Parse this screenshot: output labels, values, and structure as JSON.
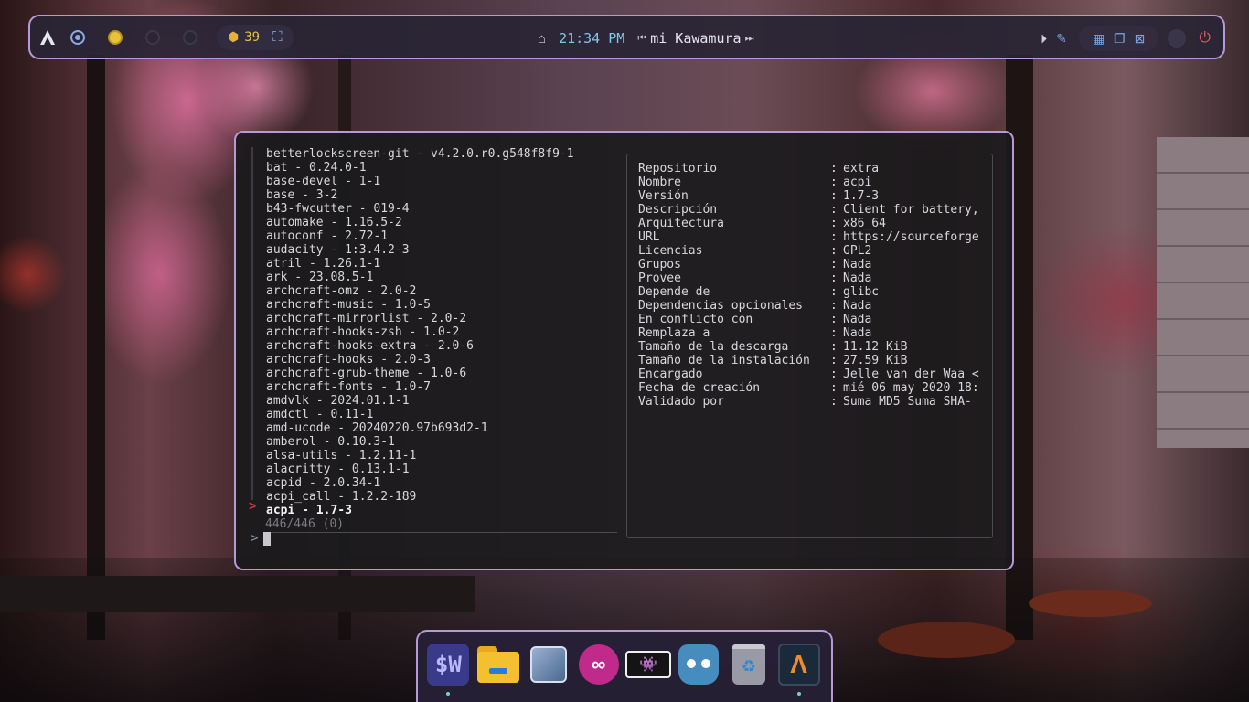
{
  "topbar": {
    "launcher_icon": "arch-logo-icon",
    "workspaces": [
      "workspace-1",
      "workspace-2",
      "workspace-3",
      "workspace-4"
    ],
    "updates_count": "39",
    "clock": "21:34 PM",
    "now_playing": "mi Kawamura"
  },
  "terminal": {
    "packages": [
      "betterlockscreen-git - v4.2.0.r0.g548f8f9-1",
      "bat - 0.24.0-1",
      "base-devel - 1-1",
      "base - 3-2",
      "b43-fwcutter - 019-4",
      "automake - 1.16.5-2",
      "autoconf - 2.72-1",
      "audacity - 1:3.4.2-3",
      "atril - 1.26.1-1",
      "ark - 23.08.5-1",
      "archcraft-omz - 2.0-2",
      "archcraft-music - 1.0-5",
      "archcraft-mirrorlist - 2.0-2",
      "archcraft-hooks-zsh - 1.0-2",
      "archcraft-hooks-extra - 2.0-6",
      "archcraft-hooks - 2.0-3",
      "archcraft-grub-theme - 1.0-6",
      "archcraft-fonts - 1.0-7",
      "amdvlk - 2024.01.1-1",
      "amdctl - 0.11-1",
      "amd-ucode - 20240220.97b693d2-1",
      "amberol - 0.10.3-1",
      "alsa-utils - 1.2.11-1",
      "alacritty - 0.13.1-1",
      "acpid - 2.0.34-1",
      "acpi_call - 1.2.2-189"
    ],
    "selected_package": "acpi - 1.7-3",
    "match_count": "446/446 (0)",
    "selection_marker": ">",
    "prompt_symbol": ">",
    "info": [
      {
        "key": "Repositorio",
        "value": "extra"
      },
      {
        "key": "Nombre",
        "value": "acpi"
      },
      {
        "key": "Versión",
        "value": "1.7-3"
      },
      {
        "key": "Descripción",
        "value": "Client for battery,"
      },
      {
        "key": "Arquitectura",
        "value": "x86_64"
      },
      {
        "key": "URL",
        "value": "https://sourceforge"
      },
      {
        "key": "Licencias",
        "value": "GPL2"
      },
      {
        "key": "Grupos",
        "value": "Nada"
      },
      {
        "key": "Provee",
        "value": "Nada"
      },
      {
        "key": "Depende de",
        "value": "glibc"
      },
      {
        "key": "Dependencias opcionales",
        "value": "Nada"
      },
      {
        "key": "En conflicto con",
        "value": "Nada"
      },
      {
        "key": "Remplaza a",
        "value": "Nada"
      },
      {
        "key": "Tamaño de la descarga",
        "value": "11.12 KiB"
      },
      {
        "key": "Tamaño de la instalación",
        "value": "27.59 KiB"
      },
      {
        "key": "Encargado",
        "value": "Jelle van der Waa <"
      },
      {
        "key": "Fecha de creación",
        "value": "mié 06 may 2020 18:"
      },
      {
        "key": "Validado por",
        "value": "Suma MD5  Suma SHA-"
      }
    ]
  },
  "dock": {
    "apps": [
      {
        "icon": "w-terminal-icon",
        "label": "$W"
      },
      {
        "icon": "file-manager-icon"
      },
      {
        "icon": "virtualbox-icon"
      },
      {
        "icon": "infinity-app-icon"
      },
      {
        "icon": "retroarch-icon"
      },
      {
        "icon": "godot-icon"
      },
      {
        "icon": "trash-icon"
      },
      {
        "icon": "alacritty-icon"
      }
    ]
  },
  "colors": {
    "accent_border": "#b59ad6",
    "clock": "#7fc9e8",
    "updates": "#e8c23a",
    "power": "#e05a5a",
    "selection_marker": "#d83a4a"
  }
}
